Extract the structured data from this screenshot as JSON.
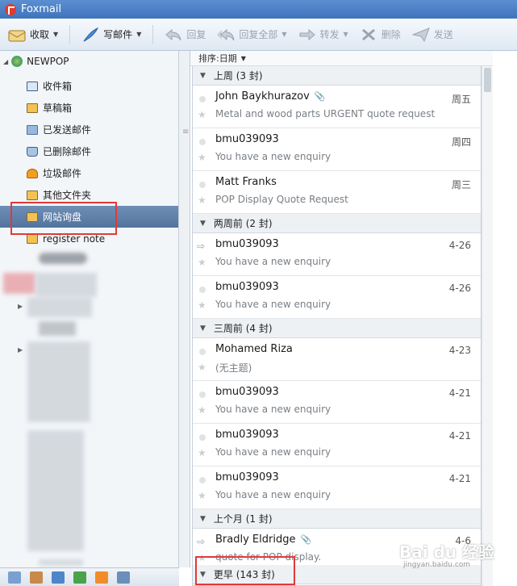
{
  "window": {
    "title": "Foxmail"
  },
  "toolbar": {
    "receive": "收取",
    "compose": "写邮件",
    "reply": "回复",
    "reply_all": "回复全部",
    "forward": "转发",
    "delete": "删除",
    "send": "发送"
  },
  "sidebar": {
    "account": "NEWPOP",
    "folders": [
      {
        "label": "收件箱",
        "icon": "inbox-icon"
      },
      {
        "label": "草稿箱",
        "icon": "drafts-icon"
      },
      {
        "label": "已发送邮件",
        "icon": "sent-icon"
      },
      {
        "label": "已删除邮件",
        "icon": "trash-icon"
      },
      {
        "label": "垃圾邮件",
        "icon": "spam-icon"
      },
      {
        "label": "其他文件夹",
        "icon": "folder-icon"
      },
      {
        "label": "网站询盘",
        "icon": "folder-icon"
      },
      {
        "label": "register note",
        "icon": "folder-icon"
      }
    ]
  },
  "list": {
    "sort_label": "排序:日期",
    "groups": [
      {
        "label": "上周 (3 封)"
      },
      {
        "label": "两周前 (2 封)"
      },
      {
        "label": "三周前 (4 封)"
      },
      {
        "label": "上个月 (1 封)"
      },
      {
        "label": "更早 (143 封)"
      }
    ],
    "messages": [
      {
        "from": "John Baykhurazov",
        "subject": "Metal and wood parts URGENT quote request",
        "date": "周五",
        "attach": true
      },
      {
        "from": "bmu039093",
        "subject": "You have a new enquiry",
        "date": "周四",
        "attach": false
      },
      {
        "from": "Matt Franks",
        "subject": "POP Display Quote Request",
        "date": "周三",
        "attach": false
      },
      {
        "from": "bmu039093",
        "subject": "You have a new enquiry",
        "date": "4-26",
        "attach": false
      },
      {
        "from": "bmu039093",
        "subject": "You have a new enquiry",
        "date": "4-26",
        "attach": false
      },
      {
        "from": "Mohamed Riza",
        "subject": "(无主题)",
        "date": "4-23",
        "attach": false
      },
      {
        "from": "bmu039093",
        "subject": "You have a new enquiry",
        "date": "4-21",
        "attach": false
      },
      {
        "from": "bmu039093",
        "subject": "You have a new enquiry",
        "date": "4-21",
        "attach": false
      },
      {
        "from": "bmu039093",
        "subject": "You have a new enquiry",
        "date": "4-21",
        "attach": false
      },
      {
        "from": "Bradly Eldridge",
        "subject": "quote for POP display.",
        "date": "4-6",
        "attach": true
      }
    ]
  },
  "watermark": {
    "brand": "Bai du 经验",
    "url": "jingyan.baidu.com"
  },
  "colors": {
    "titlebar": "#3e74bd",
    "selected_folder": "#52739d",
    "highlight_box": "#e03a3a"
  }
}
